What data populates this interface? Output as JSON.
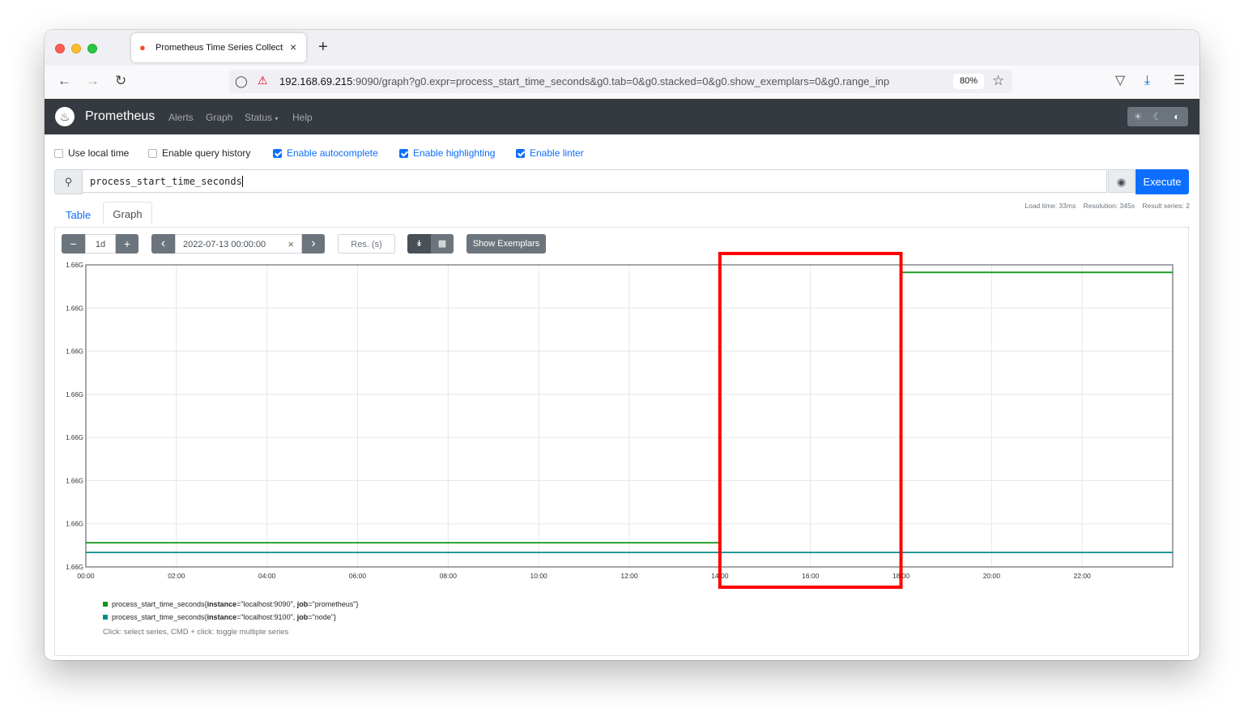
{
  "browser": {
    "tab": {
      "title": "Prometheus Time Series Collecti",
      "favicon": "flame-icon",
      "close": "×"
    },
    "new_tab": "+",
    "nav": {
      "back": "←",
      "forward": "→",
      "reload": "↻"
    },
    "url": {
      "host": "192.168.69.215",
      "rest": ":9090/graph?g0.expr=process_start_time_seconds&g0.tab=0&g0.stacked=0&g0.show_exemplars=0&g0.range_inp",
      "zoom": "80%"
    },
    "icons": {
      "shield": "shield-icon",
      "lock": "insecure-lock-icon",
      "star": "star-icon",
      "pocket": "pocket-icon",
      "download": "download-icon",
      "menu": "menu-icon"
    }
  },
  "prometheus": {
    "brand": "Prometheus",
    "nav": [
      "Alerts",
      "Graph",
      "Status",
      "Help"
    ],
    "status_caret": "▾",
    "options": [
      {
        "label": "Use local time",
        "checked": false
      },
      {
        "label": "Enable query history",
        "checked": false
      },
      {
        "label": "Enable autocomplete",
        "checked": true
      },
      {
        "label": "Enable highlighting",
        "checked": true
      },
      {
        "label": "Enable linter",
        "checked": true
      }
    ],
    "query": "process_start_time_seconds",
    "execute_label": "Execute",
    "stats": "Load time: 33ms    Resolution: 345s    Result series: 2",
    "tabs": {
      "table": "Table",
      "graph": "Graph"
    },
    "controls": {
      "minus": "−",
      "range": "1d",
      "plus": "+",
      "prev": "‹",
      "end_time": "2022-07-13 00:00:00",
      "clear": "×",
      "next": "›",
      "res_placeholder": "Res. (s)",
      "show_exemplars": "Show Exemplars"
    },
    "hint": "Click: select series, CMD + click: toggle multiple series"
  },
  "chart_data": {
    "type": "line",
    "x_ticks": [
      "00:00",
      "02:00",
      "04:00",
      "06:00",
      "08:00",
      "10:00",
      "12:00",
      "14:00",
      "16:00",
      "18:00",
      "20:00",
      "22:00"
    ],
    "y_ticks": [
      "1.66G",
      "1.66G",
      "1.66G",
      "1.66G",
      "1.66G",
      "1.66G",
      "1.66G",
      "1.66G"
    ],
    "x_range_hours": [
      0,
      24
    ],
    "y_range_relative": [
      0,
      1
    ],
    "grid": true,
    "series": [
      {
        "name": "process_start_time_seconds{instance=\"localhost:9090\", job=\"prometheus\"}",
        "name_prefix": "process_start_time_seconds{",
        "label1_key": "instance",
        "label1_val": "=\"localhost:9090\", ",
        "label2_key": "job",
        "label2_val": "=\"prometheus\"}",
        "color": "#109618",
        "segments": [
          {
            "x": [
              0,
              14
            ],
            "y": 0.08
          },
          {
            "x": [
              18,
              24
            ],
            "y": 0.975
          }
        ]
      },
      {
        "name": "process_start_time_seconds{instance=\"localhost:9100\", job=\"node\"}",
        "name_prefix": "process_start_time_seconds{",
        "label1_key": "instance",
        "label1_val": "=\"localhost:9100\", ",
        "label2_key": "job",
        "label2_val": "=\"node\"}",
        "color": "#0a8b8b",
        "segments": [
          {
            "x": [
              0,
              24
            ],
            "y": 0.08
          }
        ]
      }
    ],
    "annotation": {
      "type": "highlight-rectangle",
      "color": "#ff0000",
      "x": [
        14,
        18
      ]
    }
  }
}
